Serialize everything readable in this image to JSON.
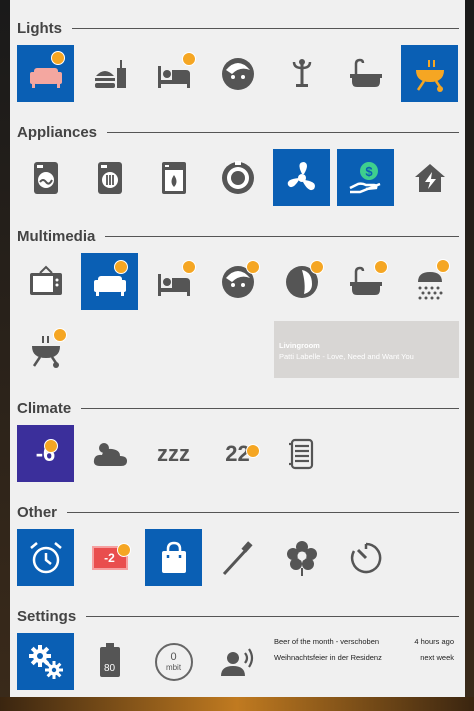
{
  "sections": {
    "lights": "Lights",
    "appliances": "Appliances",
    "multimedia": "Multimedia",
    "climate": "Climate",
    "other": "Other",
    "settings": "Settings"
  },
  "colors": {
    "active_tile": "#0a5fb4",
    "climate_tile": "#3b2f9b",
    "badge": "#f5a623",
    "icon": "#555555",
    "fan_color": "#ffffff"
  },
  "lights": {
    "icons": [
      "sofa-icon",
      "burger-drink-icon",
      "bed-icon",
      "face-icon",
      "coat-stand-icon",
      "bathtub-icon",
      "grill-icon"
    ]
  },
  "appliances": {
    "icons": [
      "washer-icon",
      "dryer-icon",
      "dishwasher-icon",
      "robot-vacuum-icon",
      "fan-icon",
      "money-hand-icon",
      "home-power-icon"
    ]
  },
  "multimedia": {
    "icons": [
      "tv-icon",
      "sofa-icon",
      "bed-icon",
      "face-icon",
      "head-icon",
      "bathtub-icon",
      "shower-icon",
      "grill-icon"
    ],
    "now_playing": {
      "room": "Livingroom",
      "track": "Patti Labelle - Love, Need and Want You"
    }
  },
  "climate": {
    "outdoor_temp": "-6",
    "weather_icon": "cloud-icon",
    "sleep_text": "zzz",
    "room_temp": "22",
    "heater_icon": "radiator-icon"
  },
  "other": {
    "icons": [
      "alarm-clock-icon",
      "countdown-tile-icon",
      "shopping-bag-icon",
      "toothbrush-icon",
      "flower-icon",
      "timer-icon"
    ],
    "countdown_value": "-2"
  },
  "settings": {
    "battery_level": "80",
    "speed_value": "0",
    "speed_unit": "mbit",
    "events": [
      {
        "title": "Beer of the month - verschoben",
        "when": "4 hours ago"
      },
      {
        "title": "Weihnachtsfeier in der Residenz",
        "when": "next week"
      }
    ]
  }
}
